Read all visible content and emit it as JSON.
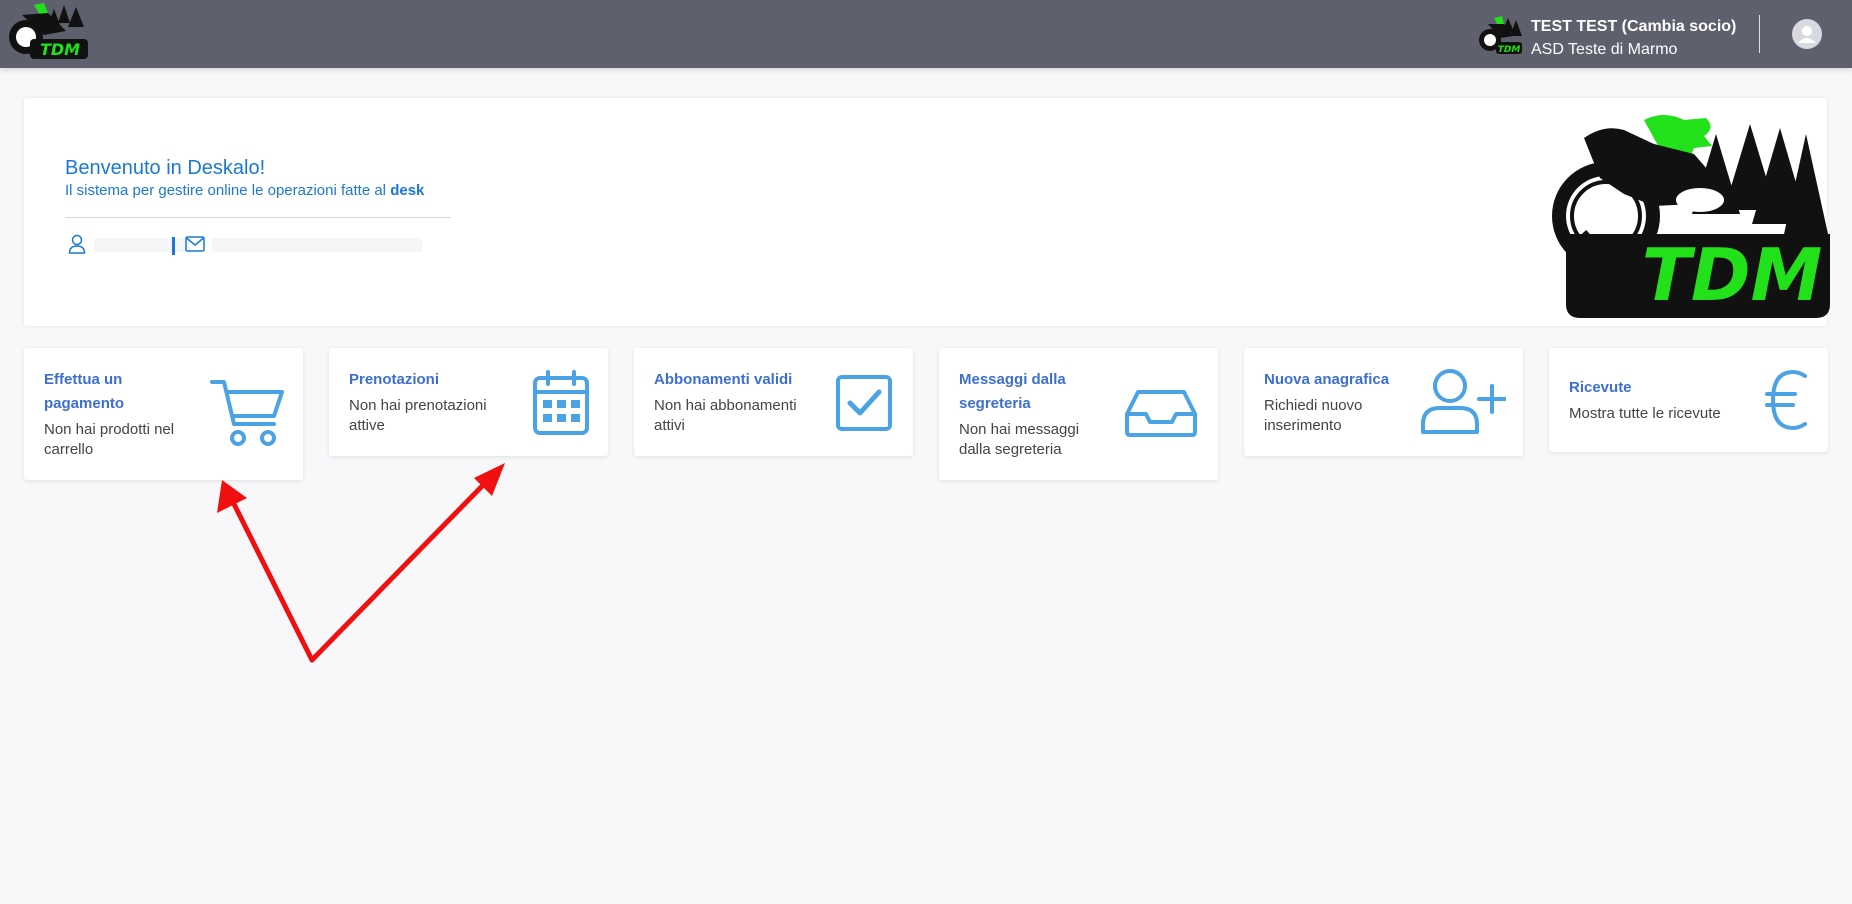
{
  "topbar": {
    "user_name": "TEST TEST (Cambia socio)",
    "organization": "ASD Teste di Marmo",
    "logo_text": "TDM"
  },
  "welcome": {
    "title": "Benvenuto in Deskalo!",
    "subtitle_prefix": "Il sistema per gestire online le operazioni fatte al ",
    "subtitle_bold": "desk",
    "logo_text": "TDM"
  },
  "tiles": [
    {
      "title_l1": "Effettua un",
      "title_l2": "pagamento",
      "desc_l1": "Non hai prodotti nel",
      "desc_l2": "carrello",
      "icon": "cart-icon"
    },
    {
      "title_l1": "Prenotazioni",
      "desc_l1": "Non hai prenotazioni",
      "desc_l2": "attive",
      "icon": "calendar-icon"
    },
    {
      "title_l1": "Abbonamenti validi",
      "desc_l1": "Non hai abbonamenti",
      "desc_l2": "attivi",
      "icon": "checkbox-icon"
    },
    {
      "title_l1": "Messaggi dalla",
      "title_l2": "segreteria",
      "desc_l1": "Non hai messaggi",
      "desc_l2": "dalla segreteria",
      "icon": "inbox-icon"
    },
    {
      "title_l1": "Nuova anagrafica",
      "desc_l1": "Richiedi nuovo",
      "desc_l2": "inserimento",
      "icon": "add-user-icon"
    },
    {
      "title_l1": "Ricevute",
      "desc_l1": "Mostra tutte le ricevute",
      "icon": "euro-icon"
    }
  ],
  "colors": {
    "topbar": "#5e606e",
    "accent": "#1a79d6",
    "tile_title": "#3c6fd0",
    "tile_icon": "#4ba3e6",
    "annotation_arrow": "#f01010",
    "logo_green": "#22e01a"
  }
}
